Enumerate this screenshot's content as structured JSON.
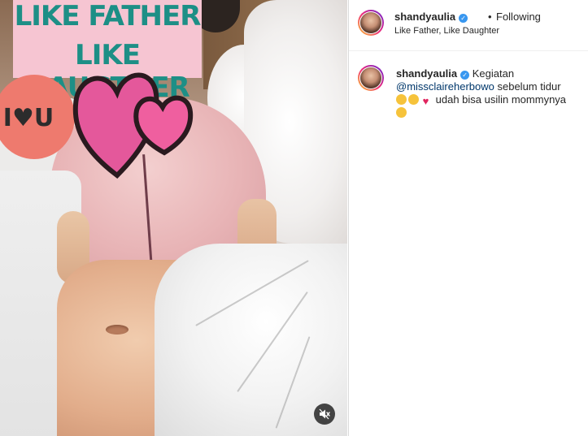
{
  "post": {
    "media": {
      "sticker_line1": "LIKE FATHER",
      "sticker_line2": "LIKE DAUGTHER",
      "sticker_badge": "I♥U",
      "mute_icon": "speaker-muted-icon"
    },
    "header": {
      "username": "shandyaulia",
      "separator": "•",
      "follow_status": "Following",
      "location": "Like Father, Like Daughter"
    },
    "caption": {
      "username": "shandyaulia",
      "text_1": "Kegiatan",
      "mention": "@missclaireherbowo",
      "text_2": "sebelum tidur",
      "text_3": "udah bisa usilin mommynya"
    },
    "colors": {
      "accent_verified": "#3897f0",
      "mention": "#00376b",
      "sticker_bg": "#f6c5d2",
      "sticker_text": "#1d8f86",
      "badge_bg": "#ee7a6e",
      "heart_pink": "#e4589b"
    }
  }
}
